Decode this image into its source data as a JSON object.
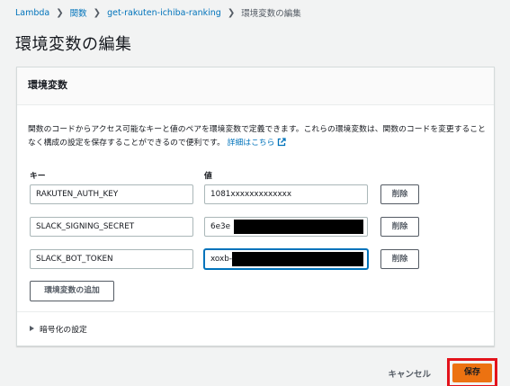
{
  "breadcrumb": {
    "items": [
      "Lambda",
      "関数",
      "get-rakuten-ichiba-ranking"
    ],
    "current": "環境変数の編集"
  },
  "page_title": "環境変数の編集",
  "panel": {
    "title": "環境変数",
    "description": "関数のコードからアクセス可能なキーと値のペアを環境変数で定義できます。これらの環境変数は、関数のコードを変更することなく構成の設定を保存することができるので便利です。",
    "learn_more": "詳細はこちら",
    "key_label": "キー",
    "value_label": "値",
    "rows": [
      {
        "key": "RAKUTEN_AUTH_KEY",
        "value": "1081xxxxxxxxxxxxx",
        "delete_label": "削除"
      },
      {
        "key": "SLACK_SIGNING_SECRET",
        "value": "6e3e",
        "delete_label": "削除"
      },
      {
        "key": "SLACK_BOT_TOKEN",
        "value": "xoxb-",
        "delete_label": "削除"
      }
    ],
    "add_label": "環境変数の追加",
    "encryption_label": "暗号化の設定"
  },
  "actions": {
    "cancel_label": "キャンセル",
    "save_label": "保存"
  },
  "colors": {
    "link": "#0073bb",
    "primary_button": "#ec7211",
    "highlight_border": "#e3131b"
  }
}
